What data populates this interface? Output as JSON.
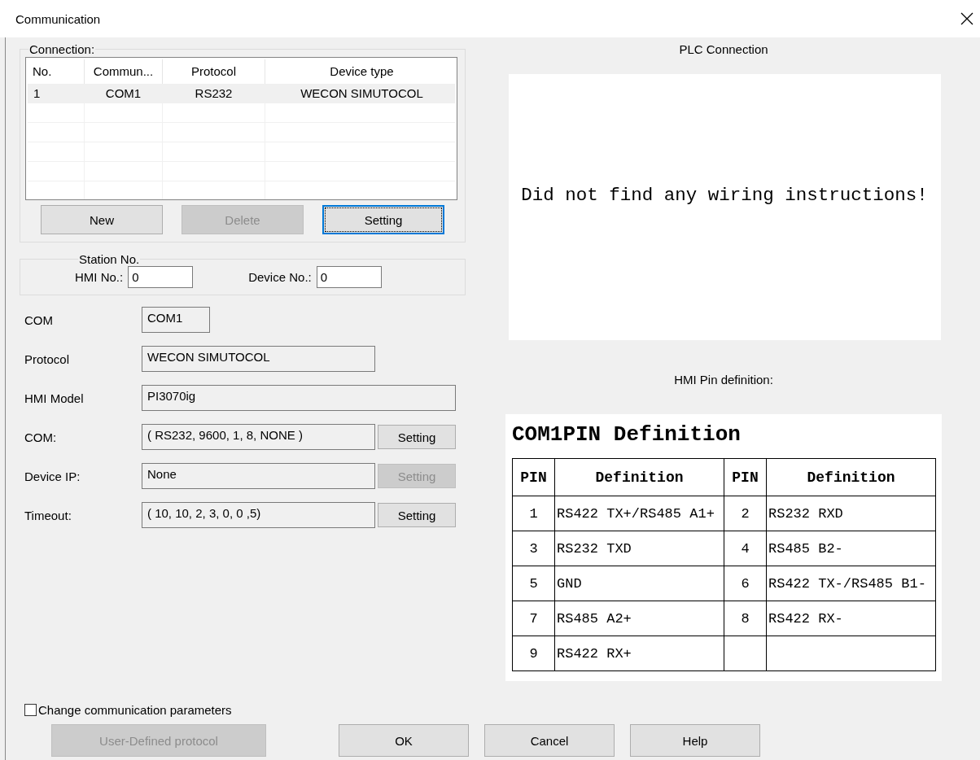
{
  "window": {
    "title": "Communication"
  },
  "connection": {
    "legend": "Connection:",
    "columns": [
      "No.",
      "Commun...",
      "Protocol",
      "Device type"
    ],
    "rows": [
      {
        "cells": [
          "1",
          "COM1",
          "RS232",
          "WECON SIMUTOCOL"
        ],
        "selected": true
      }
    ],
    "buttons": [
      {
        "label": "New",
        "disabled": false,
        "focused": false
      },
      {
        "label": "Delete",
        "disabled": true,
        "focused": false
      },
      {
        "label": "Setting",
        "disabled": false,
        "focused": true
      }
    ]
  },
  "station": {
    "legend": "Station No.",
    "fields": [
      {
        "label": "HMI No.:",
        "value": "0"
      },
      {
        "label": "Device No.:",
        "value": "0"
      }
    ]
  },
  "settings": [
    {
      "kind": "short",
      "label": "COM",
      "value": "COM1"
    },
    {
      "kind": "medium",
      "label": "Protocol",
      "value": "WECON SIMUTOCOL"
    },
    {
      "kind": "wide",
      "label": "HMI Model",
      "value": "PI3070ig"
    },
    {
      "kind": "button",
      "label": "COM:",
      "value": "( RS232, 9600, 1, 8, NONE )",
      "button": {
        "label": "Setting",
        "disabled": false
      }
    },
    {
      "kind": "button",
      "label": "Device IP:",
      "value": "None",
      "button": {
        "label": "Setting",
        "disabled": true
      }
    },
    {
      "kind": "button",
      "label": "Timeout:",
      "value": "( 10, 10, 2, 3, 0, 0 ,5)",
      "button": {
        "label": "Setting",
        "disabled": false
      }
    }
  ],
  "plc_connection": {
    "title": "PLC Connection",
    "message": "Did not find any wiring instructions!"
  },
  "pin_definition": {
    "label": "HMI Pin definition:",
    "title": "COM1PIN Definition",
    "columns": [
      "PIN",
      "Definition",
      "PIN",
      "Definition"
    ],
    "rows": [
      [
        "1",
        "RS422 TX+/RS485 A1+",
        "2",
        "RS232 RXD"
      ],
      [
        "3",
        "RS232 TXD",
        "4",
        "RS485 B2-"
      ],
      [
        "5",
        "GND",
        "6",
        "RS422 TX-/RS485 B1-"
      ],
      [
        "7",
        "RS485 A2+",
        "8",
        "RS422 RX-"
      ],
      [
        "9",
        "RS422 RX+"
      ]
    ]
  },
  "change_params": {
    "label": "Change communication parameters",
    "checked": false
  },
  "footer_buttons": [
    {
      "label": "User-Defined protocol",
      "disabled": true
    },
    {
      "label": "OK",
      "disabled": false
    },
    {
      "label": "Cancel",
      "disabled": false
    },
    {
      "label": "Help",
      "disabled": false
    }
  ]
}
